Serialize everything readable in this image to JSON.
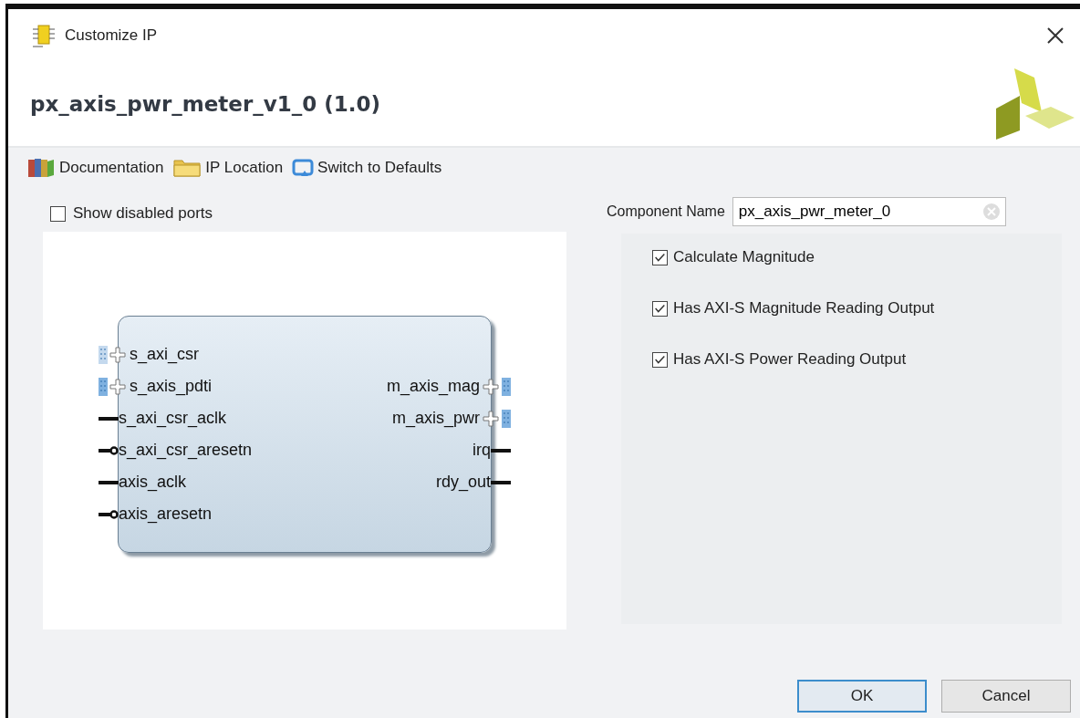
{
  "window": {
    "title": "Customize IP"
  },
  "header": {
    "title": "px_axis_pwr_meter_v1_0 (1.0)"
  },
  "toolbar": [
    {
      "kind": "books",
      "label": "Documentation"
    },
    {
      "kind": "folder",
      "label": "IP Location"
    },
    {
      "kind": "reset",
      "label": "Switch to Defaults"
    }
  ],
  "left_panel": {
    "show_disabled_ports": {
      "label": "Show disabled ports",
      "checked": false
    },
    "block": {
      "left_ports": [
        {
          "name": "s_axi_csr",
          "kind": "aximm"
        },
        {
          "name": "s_axis_pdti",
          "kind": "axis"
        },
        {
          "name": "s_axi_csr_aclk",
          "kind": "wire"
        },
        {
          "name": "s_axi_csr_aresetn",
          "kind": "reset"
        },
        {
          "name": "axis_aclk",
          "kind": "wire"
        },
        {
          "name": "axis_aresetn",
          "kind": "reset"
        }
      ],
      "right_ports": [
        {
          "name": "m_axis_mag",
          "kind": "axis"
        },
        {
          "name": "m_axis_pwr",
          "kind": "axis"
        },
        {
          "name": "irq",
          "kind": "wire"
        },
        {
          "name": "rdy_out",
          "kind": "wire"
        }
      ]
    }
  },
  "right_panel": {
    "component_name": {
      "label": "Component Name",
      "value": "px_axis_pwr_meter_0"
    },
    "options": [
      {
        "label": "Calculate Magnitude",
        "checked": true
      },
      {
        "label": "Has AXI-S Magnitude Reading Output",
        "checked": true
      },
      {
        "label": "Has AXI-S Power Reading Output",
        "checked": true
      }
    ]
  },
  "buttons": [
    {
      "label": "OK",
      "default": true
    },
    {
      "label": "Cancel",
      "default": false
    }
  ]
}
